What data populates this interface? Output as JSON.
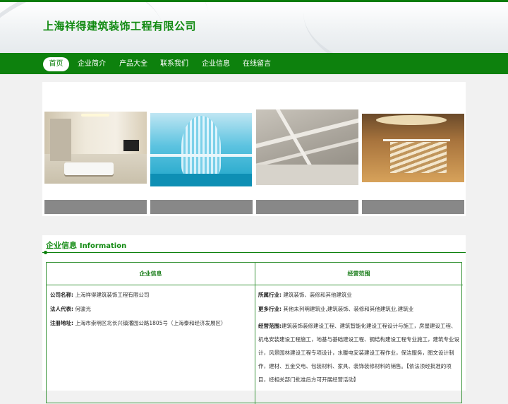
{
  "header": {
    "title": "上海祥得建筑装饰工程有限公司"
  },
  "nav": {
    "items": [
      "首页",
      "企业简介",
      "产品大全",
      "联系我们",
      "企业信息",
      "在线留言"
    ],
    "active_index": 0
  },
  "banner": {
    "slides": [
      "living-room",
      "blue-atrium",
      "ceiling-grid",
      "lobby-stairs"
    ]
  },
  "info": {
    "heading_cn": "企业信息",
    "heading_en": "Information",
    "col_left_header": "企业信息",
    "col_right_header": "经营范围",
    "company_name_label": "公司名称:",
    "company_name_value": "上海祥得建筑装饰工程有限公司",
    "legal_rep_label": "法人代表:",
    "legal_rep_value": "何骏光",
    "address_label": "注册地址:",
    "address_value": "上海市崇明区北长兴镇潘园公路1805号（上海泰和经济发展区）",
    "industry_label": "所属行业:",
    "industry_value": "建筑装饰、装修和其他建筑业",
    "more_industry_label": "更多行业:",
    "more_industry_value": "其他未列明建筑业,建筑装饰、装修和其他建筑业,建筑业",
    "scope_label": "经营范围:",
    "scope_value": "建筑装饰装修建设工程、建筑智能化建设工程设计与施工，房屋建设工程、机电安装建设工程施工，地基与基础建设工程、钢结构建设工程专业施工，建筑专业设计，风景园林建设工程专项设计，水暖电安装建设工程作业，保洁服务，图文设计制作，建材、五金交电、包装材料、家具、装饰装修材料的销售。【依法须经批准的项目，经相关部门批准后方可开展经营活动】"
  },
  "colors": {
    "brand_green": "#0d810d",
    "title_green": "#118a11",
    "caption_grey": "#888888"
  }
}
